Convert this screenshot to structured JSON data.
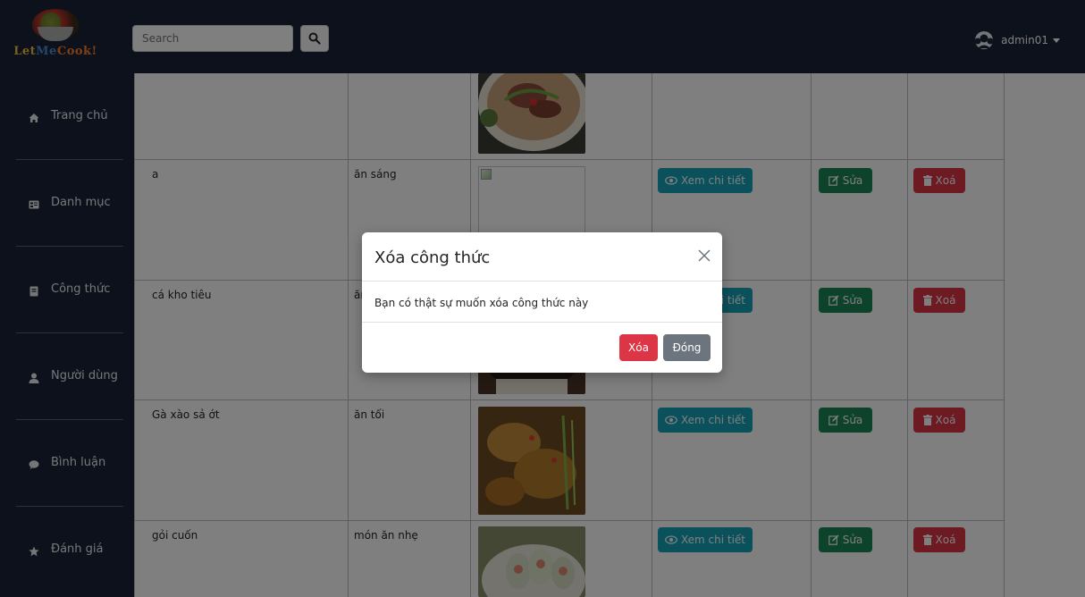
{
  "brand": {
    "logo_part1": "Let",
    "logo_part2": "Me",
    "logo_part3": "Cook!"
  },
  "search": {
    "placeholder": "Search"
  },
  "user": {
    "name": "admin01"
  },
  "sidebar": {
    "items": [
      {
        "label": "Trang chủ",
        "icon": "home-icon"
      },
      {
        "label": "Danh mục",
        "icon": "list-icon"
      },
      {
        "label": "Công thức",
        "icon": "book-icon"
      },
      {
        "label": "Người dùng",
        "icon": "user-icon"
      },
      {
        "label": "Bình luận",
        "icon": "comment-icon"
      },
      {
        "label": "Đánh giá",
        "icon": "star-icon"
      }
    ]
  },
  "table": {
    "rows": [
      {
        "name": "",
        "category": "",
        "image": "pho-bowl"
      },
      {
        "name": "a",
        "category": "ăn sáng",
        "image": "broken"
      },
      {
        "name": "cá kho tiêu",
        "category": "ăn",
        "image": "braised-fish"
      },
      {
        "name": "Gà xào sả ớt",
        "category": "ăn tối",
        "image": "lemongrass-chicken"
      },
      {
        "name": "gỏi cuốn",
        "category": "món ăn nhẹ",
        "image": "spring-rolls"
      }
    ],
    "actions": {
      "view_label": "Xem chi tiết",
      "view_label_partial": "tiết",
      "edit_label": "Sửa",
      "delete_label": "Xoá"
    }
  },
  "modal": {
    "title": "Xóa công thức",
    "body": "Bạn có thật sự muốn xóa công thức này",
    "confirm_label": "Xóa",
    "close_label": "Đóng"
  },
  "colors": {
    "topbar": "#1b2337",
    "info": "#17a2b8",
    "success": "#198754",
    "danger": "#dc3545",
    "secondary": "#6c757d"
  }
}
